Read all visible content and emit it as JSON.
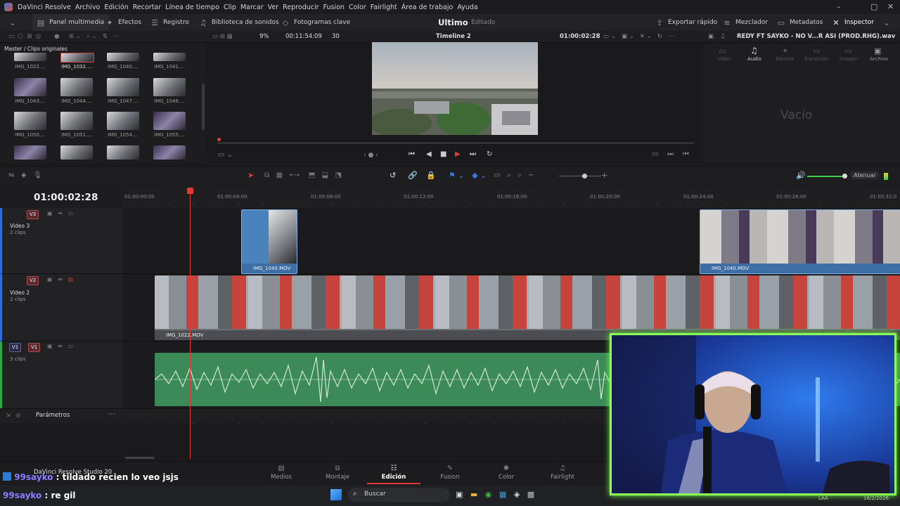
{
  "menubar": {
    "items": [
      "DaVinci Resolve",
      "Archivo",
      "Edición",
      "Recortar",
      "Línea de tiempo",
      "Clip",
      "Marcar",
      "Ver",
      "Reproducir",
      "Fusion",
      "Color",
      "Fairlight",
      "Área de trabajo",
      "Ayuda"
    ]
  },
  "toolbar": {
    "media_pool": "Panel multimedia",
    "effects": "Efectos",
    "edit_index": "Registro",
    "sound_library": "Biblioteca de sonidos",
    "keyframes": "Fotogramas clave",
    "project_name": "Ultimo",
    "project_status": "Editado",
    "quick_export": "Exportar rápido",
    "mixer": "Mezclador",
    "metadata": "Metadatos",
    "inspector": "Inspector"
  },
  "viewer": {
    "zoom": "9%",
    "source_timecode": "00:11:54:09",
    "fps": "30",
    "timeline_name": "Timeline 2",
    "timecode": "01:00:02:28",
    "inspector_file": "REDY FT SAYKO - NO V...R ASI (PROD.RHG).wav"
  },
  "media_pool": {
    "breadcrumb": "Master / Clips originales",
    "clips": [
      "IMG_1022....",
      "IMG_1032....",
      "IMG_1040....",
      "IMG_1041....",
      "IMG_1043....",
      "IMG_1044....",
      "IMG_1047....",
      "IMG_1048....",
      "IMG_1050....",
      "IMG_1051....",
      "IMG_1054....",
      "IMG_1055...."
    ]
  },
  "inspector": {
    "tabs": [
      "Video",
      "Audio",
      "Efectos",
      "Transición",
      "Imagen",
      "Archivo"
    ],
    "empty": "Vacío"
  },
  "timeline": {
    "timecode": "01:00:02:28",
    "ruler": [
      "01:00:00:00",
      "01:00:04:00",
      "01:00:08:00",
      "01:00:12:00",
      "01:00:16:00",
      "01:00:20:00",
      "01:00:24:00",
      "01:00:28:00",
      "01:00:32:0"
    ],
    "atenuar": "Atenuar",
    "tracks": [
      {
        "id": "V3",
        "name": "Video 3",
        "clips": "2 clips"
      },
      {
        "id": "V2",
        "name": "Video 2",
        "clips": "2 clips"
      },
      {
        "id": "V1",
        "src": "V1",
        "clips": "3 clips"
      }
    ],
    "clip_v3a": "IMG_1040.MOV",
    "clip_v3b": "IMG_1040.MOV",
    "clip_v2": "IMG_1022.MOV",
    "parameters": "Parámetros"
  },
  "pages": [
    "Medios",
    "Montaje",
    "Edición",
    "Fusion",
    "Color",
    "Fairlight"
  ],
  "studio": "DaVinci Resolve Studio 20",
  "taskbar": {
    "search": "Buscar",
    "lang": "LAA",
    "date": "16/2/2026"
  },
  "chat": [
    {
      "user": "99sayko",
      "sep": ":",
      "msg": "tildado recien lo veo jsjs"
    },
    {
      "user": "99sayko",
      "sep": ":",
      "msg": "re gil"
    }
  ],
  "colors": {
    "accent": "#e03b3b",
    "audio": "#3c8a58",
    "cam_border": "#8bff55",
    "clip_blue": "#5b86b8"
  }
}
